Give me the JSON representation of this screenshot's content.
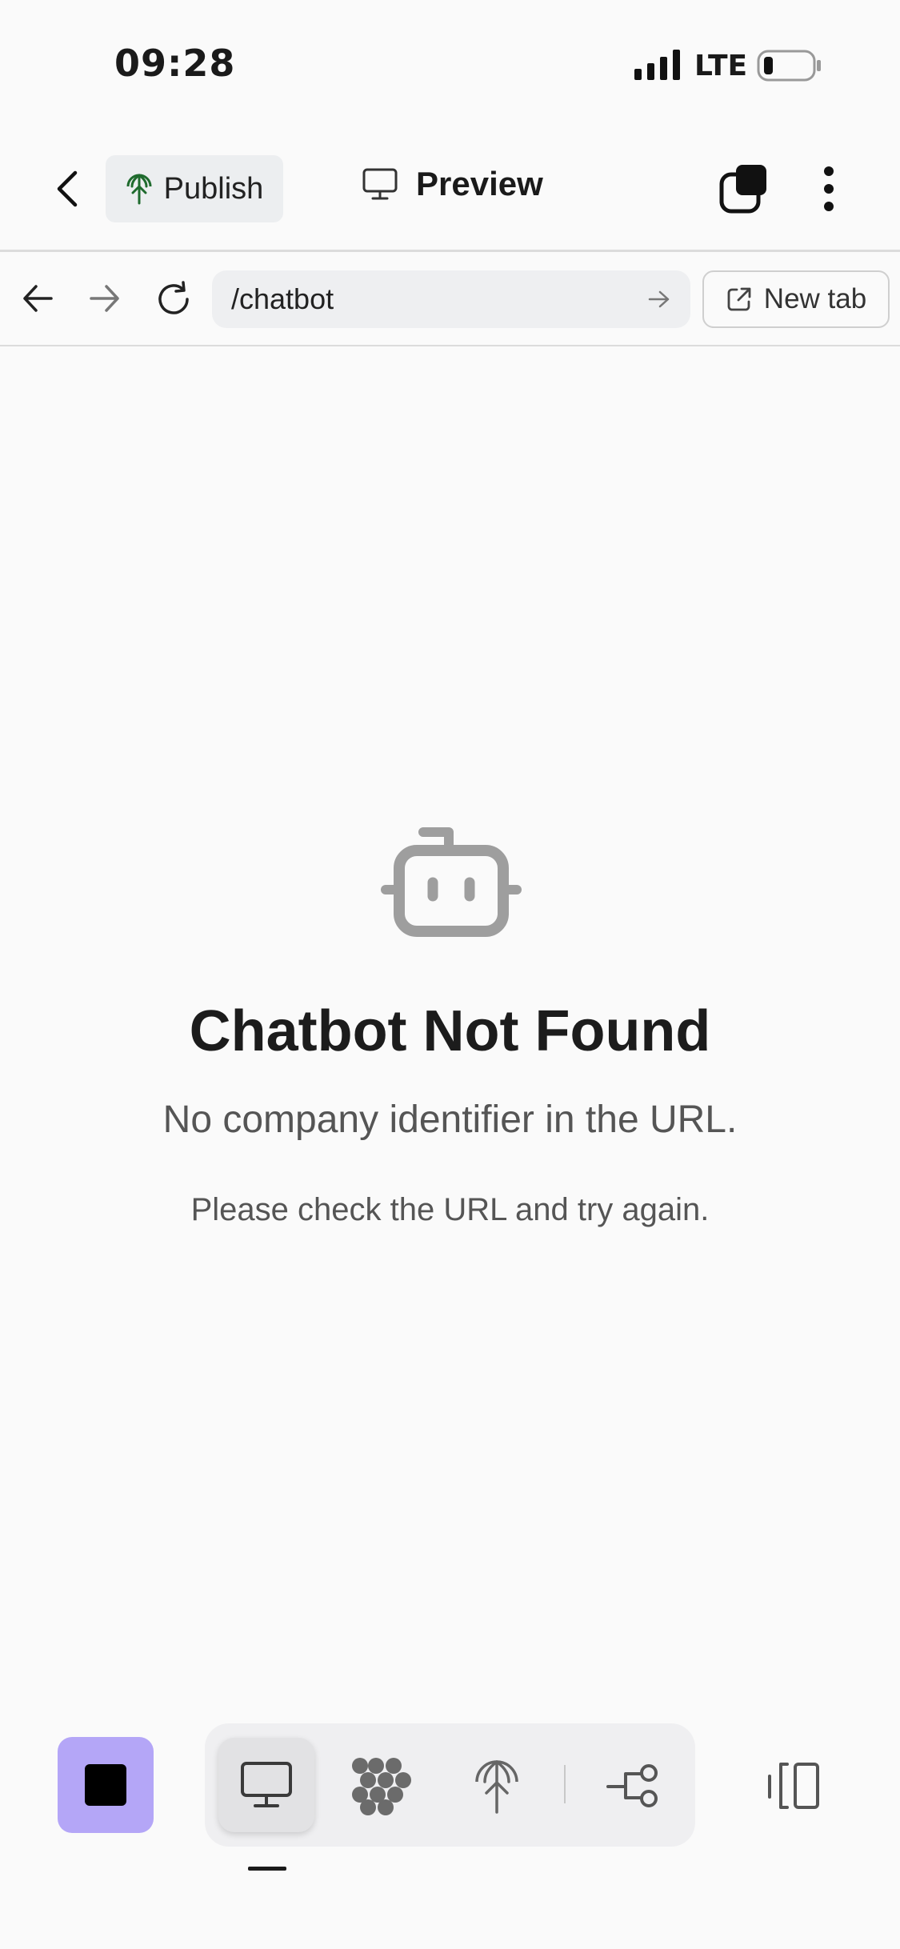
{
  "status_bar": {
    "time": "09:28",
    "network": "LTE",
    "icons": [
      "signal-icon",
      "battery-icon"
    ]
  },
  "toolbar": {
    "back_icon": "chevron-left-icon",
    "publish_label": "Publish",
    "preview_label": "Preview",
    "icons": [
      "publish-icon",
      "monitor-icon",
      "pages-icon",
      "more-vertical-icon"
    ]
  },
  "browser_bar": {
    "url": "/chatbot",
    "new_tab_label": "New tab",
    "icons": [
      "back-arrow-icon",
      "forward-arrow-icon",
      "refresh-icon",
      "go-arrow-icon",
      "external-link-icon"
    ]
  },
  "main": {
    "icon": "bot-icon",
    "title": "Chatbot Not Found",
    "subtitle": "No company identifier in the URL.",
    "hint": "Please check the URL and try again."
  },
  "bottom_bar": {
    "active_view": "preview",
    "icons": [
      "stop-icon",
      "monitor-icon",
      "cluster-icon",
      "publish-icon",
      "flow-icon",
      "panel-toggle-icon"
    ],
    "colors": {
      "stop_button": "#b4a6f7",
      "publish_icon": "#1f6b2e"
    }
  }
}
